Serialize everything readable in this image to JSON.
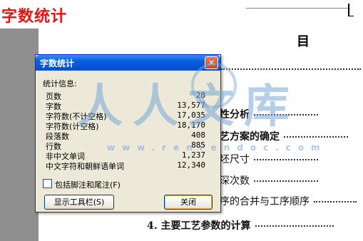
{
  "overlay": {
    "caption": "字数统计"
  },
  "document": {
    "toc_title": "目",
    "entries": [
      {
        "text": "性分析",
        "bold": true
      },
      {
        "text": "艺方案的确定",
        "bold": true
      },
      {
        "text": "坯尺寸",
        "bold": false
      },
      {
        "text": "深次数",
        "bold": false
      },
      {
        "text": "序的合并与工序顺序",
        "bold": false
      },
      {
        "text": "4. 主要工艺参数的计算",
        "bold": true
      }
    ],
    "watermark": {
      "text": "人人文库",
      "url": "www.renrendoc.com"
    }
  },
  "dialog": {
    "title": "字数统计",
    "close_glyph": "✕",
    "stats_label": "统计信息:",
    "stats": [
      {
        "name": "页数",
        "value": "28"
      },
      {
        "name": "字数",
        "value": "13,577"
      },
      {
        "name": "字符数(不计空格)",
        "value": "17,035"
      },
      {
        "name": "字符数(计空格)",
        "value": "18,170"
      },
      {
        "name": "段落数",
        "value": "408"
      },
      {
        "name": "行数",
        "value": "885"
      },
      {
        "name": "非中文单词",
        "value": "1,237"
      },
      {
        "name": "中文字符和朝鲜语单词",
        "value": "12,340"
      }
    ],
    "checkbox_label": "包括脚注和尾注(F)",
    "checkbox_checked": false,
    "toolbar_button": "显示工具栏(S)",
    "close_button": "关闭"
  },
  "colors": {
    "caption": "#ee1111",
    "titlebar": "#0a5fdd",
    "dialog_bg": "#ece9d8"
  }
}
